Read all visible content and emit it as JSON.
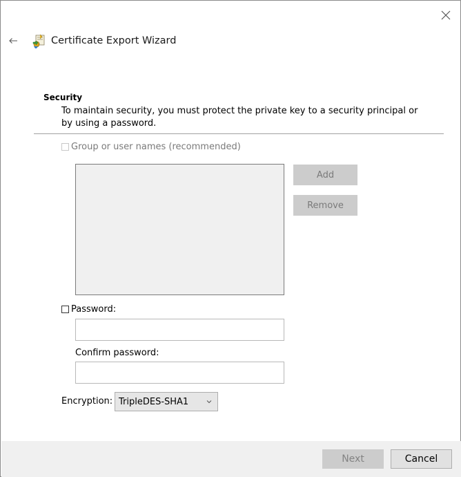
{
  "window": {
    "title": "Certificate Export Wizard",
    "close_icon": "close-icon",
    "back_icon": "back-arrow-icon",
    "app_icon": "certificate-export-icon"
  },
  "section": {
    "heading": "Security",
    "description": "To maintain security, you must protect the private key to a security principal or by using a password."
  },
  "group": {
    "checkbox_label": "Group or user names (recommended)",
    "checked": false,
    "enabled": false,
    "add_label": "Add",
    "remove_label": "Remove"
  },
  "password": {
    "checkbox_label": "Password:",
    "checked": false,
    "value": "",
    "confirm_label": "Confirm password:",
    "confirm_value": ""
  },
  "encryption": {
    "label": "Encryption:",
    "selected": "TripleDES-SHA1"
  },
  "footer": {
    "next_label": "Next",
    "cancel_label": "Cancel"
  },
  "colors": {
    "footer_bg": "#f0f0f0",
    "disabled_button": "#cccccc",
    "separator": "#a0a0a0"
  }
}
